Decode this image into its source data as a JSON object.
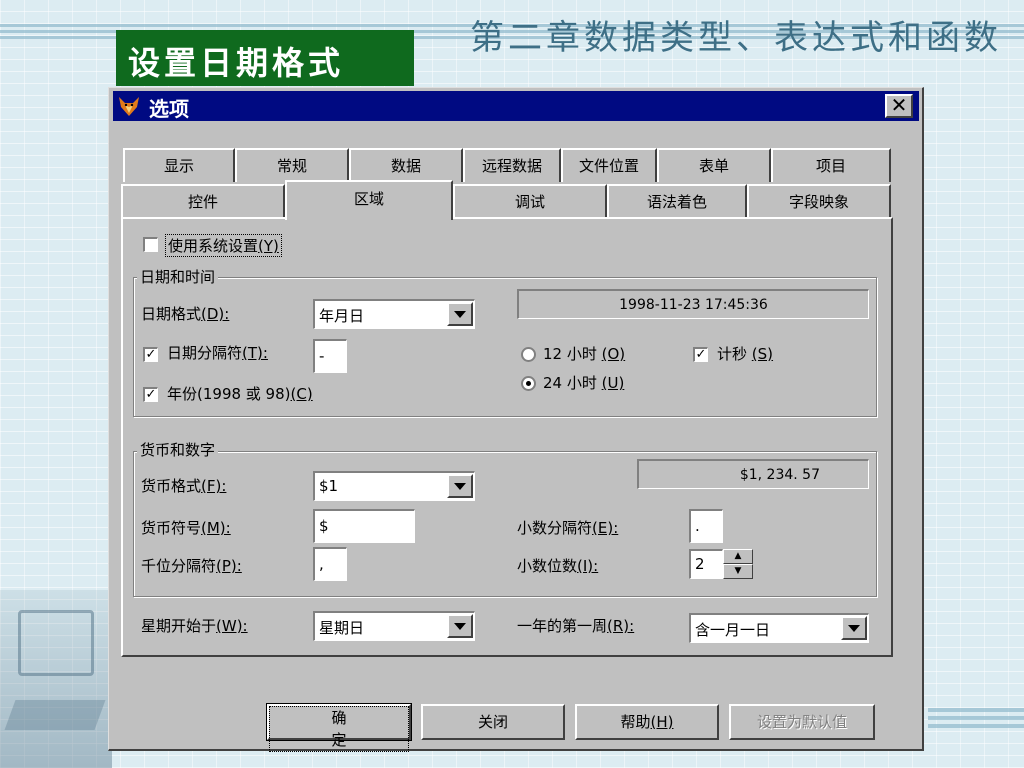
{
  "slide": {
    "heading": "第二章数据类型、表达式和函数",
    "title_box": "设置日期格式"
  },
  "dialog": {
    "title": "选项",
    "close_symbol": "✕",
    "tabs_back": [
      "显示",
      "常规",
      "数据",
      "远程数据",
      "文件位置",
      "表单",
      "项目"
    ],
    "tabs_front": [
      "控件",
      "区域",
      "调试",
      "语法着色",
      "字段映象"
    ],
    "active_tab": "区域",
    "use_system_settings": {
      "label": "使用系统设置",
      "hotkey": "(Y)",
      "checked": false
    },
    "date_time": {
      "group_title": "日期和时间",
      "date_format_label": "日期格式",
      "date_format_hotkey": "(D):",
      "date_format_value": "年月日",
      "preview": "1998-11-23 17:45:36",
      "date_separator": {
        "label": "日期分隔符",
        "hotkey": "(T):",
        "checked": true,
        "value": "-"
      },
      "year": {
        "label": "年份(1998 或 98)",
        "hotkey": "(C)",
        "checked": true
      },
      "hour12": {
        "label": "12 小时",
        "hotkey": "(O)",
        "selected": false
      },
      "hour24": {
        "label": "24 小时",
        "hotkey": "(U)",
        "selected": true
      },
      "seconds": {
        "label": "计秒",
        "hotkey": "(S)",
        "checked": true
      }
    },
    "currency": {
      "group_title": "货币和数字",
      "format_label": "货币格式",
      "format_hotkey": "(F):",
      "format_value": "$1",
      "preview": "$1, 234. 57",
      "symbol_label": "货币符号",
      "symbol_hotkey": "(M):",
      "symbol_value": "$",
      "thousands_label": "千位分隔符",
      "thousands_hotkey": "(P):",
      "thousands_value": ",",
      "decimal_sep_label": "小数分隔符",
      "decimal_sep_hotkey": "(E):",
      "decimal_sep_value": ".",
      "decimal_digits_label": "小数位数",
      "decimal_digits_hotkey": "(I):",
      "decimal_digits_value": "2"
    },
    "week_start_label": "星期开始于",
    "week_start_hotkey": "(W):",
    "week_start_value": "星期日",
    "first_week_label": "一年的第一周",
    "first_week_hotkey": "(R):",
    "first_week_value": "含一月一日",
    "buttons": {
      "ok": "确定",
      "close": "关闭",
      "help_label": "帮助",
      "help_hotkey": "(H)",
      "set_default": "设置为默认值"
    }
  },
  "colors": {
    "title_bar": "#000a82",
    "title_box": "#0f6a1e",
    "dialog_face": "#c0c0c0",
    "slide_heading": "#3e6f86"
  },
  "icons": {
    "dialog_icon": "fox-icon",
    "spinner_up": "triangle-up-icon",
    "spinner_down": "triangle-down-icon",
    "combo_arrow": "chevron-down-icon"
  }
}
